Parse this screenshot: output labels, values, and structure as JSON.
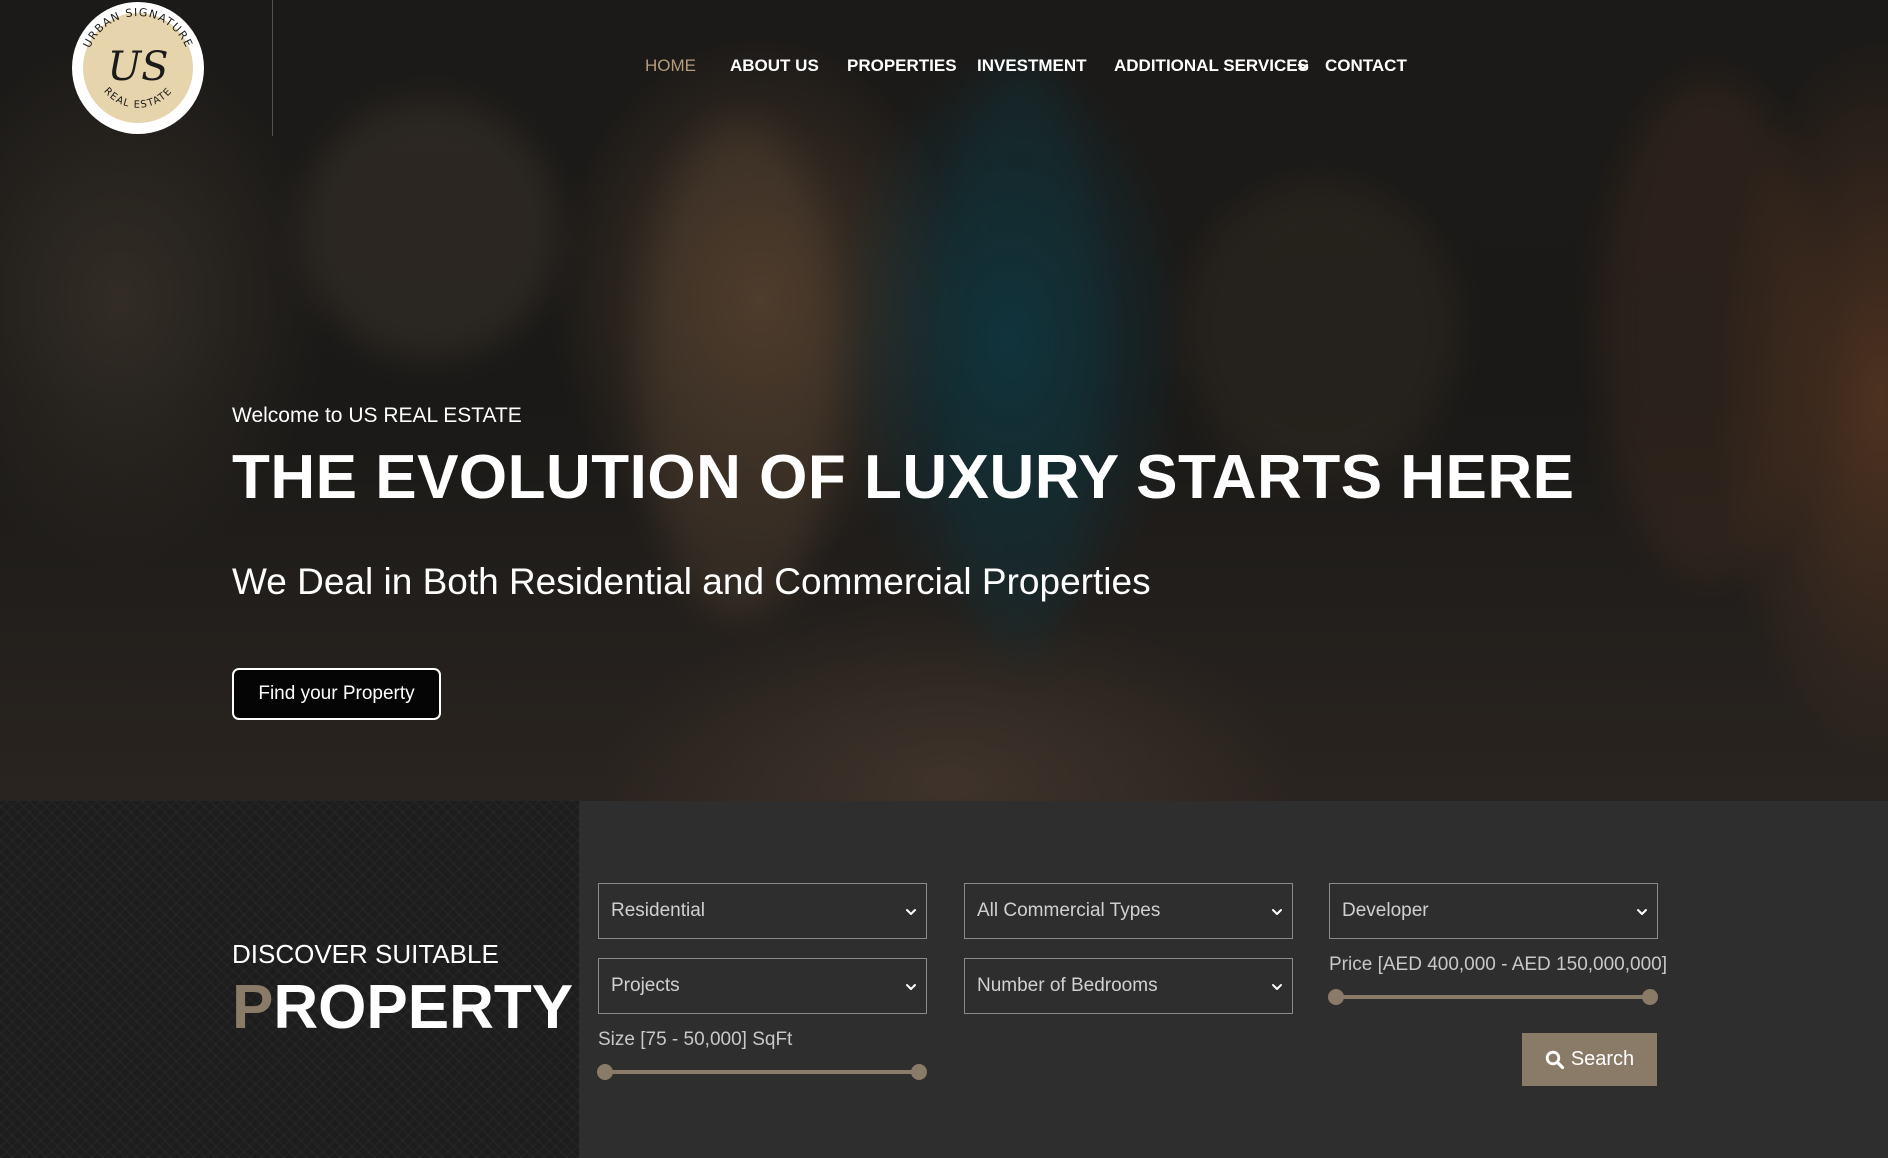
{
  "brand": {
    "logo_top_text": "URBAN SIGNATURE",
    "logo_bottom_text": "REAL ESTATE",
    "logo_monogram": "US",
    "accent_color": "#8a7a68",
    "active_nav_color": "#b59c7c"
  },
  "nav": {
    "items": [
      {
        "label": "HOME",
        "active": true
      },
      {
        "label": "ABOUT US",
        "active": false
      },
      {
        "label": "PROPERTIES",
        "active": false
      },
      {
        "label": "INVESTMENT",
        "active": false
      },
      {
        "label": "ADDITIONAL SERVICES",
        "active": false,
        "dropdown_icon": "chevron-down-icon"
      },
      {
        "label": "CONTACT",
        "active": false
      }
    ]
  },
  "hero": {
    "welcome": "Welcome to US REAL ESTATE",
    "headline": "THE EVOLUTION OF LUXURY STARTS HERE",
    "subheadline": "We Deal in Both Residential and Commercial Properties",
    "cta_label": "Find your Property"
  },
  "search": {
    "title_top": "DISCOVER SUITABLE",
    "title_first_letter": "P",
    "title_rest": "ROPERTY",
    "filters": {
      "property_category": "Residential",
      "commercial_type": "All Commercial Types",
      "developer": "Developer",
      "projects": "Projects",
      "bedrooms": "Number of Bedrooms"
    },
    "price_label": "Price [AED 400,000 - AED 150,000,000]",
    "price_range": {
      "min_fraction": 0.0,
      "max_fraction": 1.0
    },
    "size_label": "Size [75 - 50,000] SqFt",
    "size_range": {
      "min_fraction": 0.0,
      "max_fraction": 1.0
    },
    "search_label": "Search",
    "search_icon": "search-icon"
  }
}
